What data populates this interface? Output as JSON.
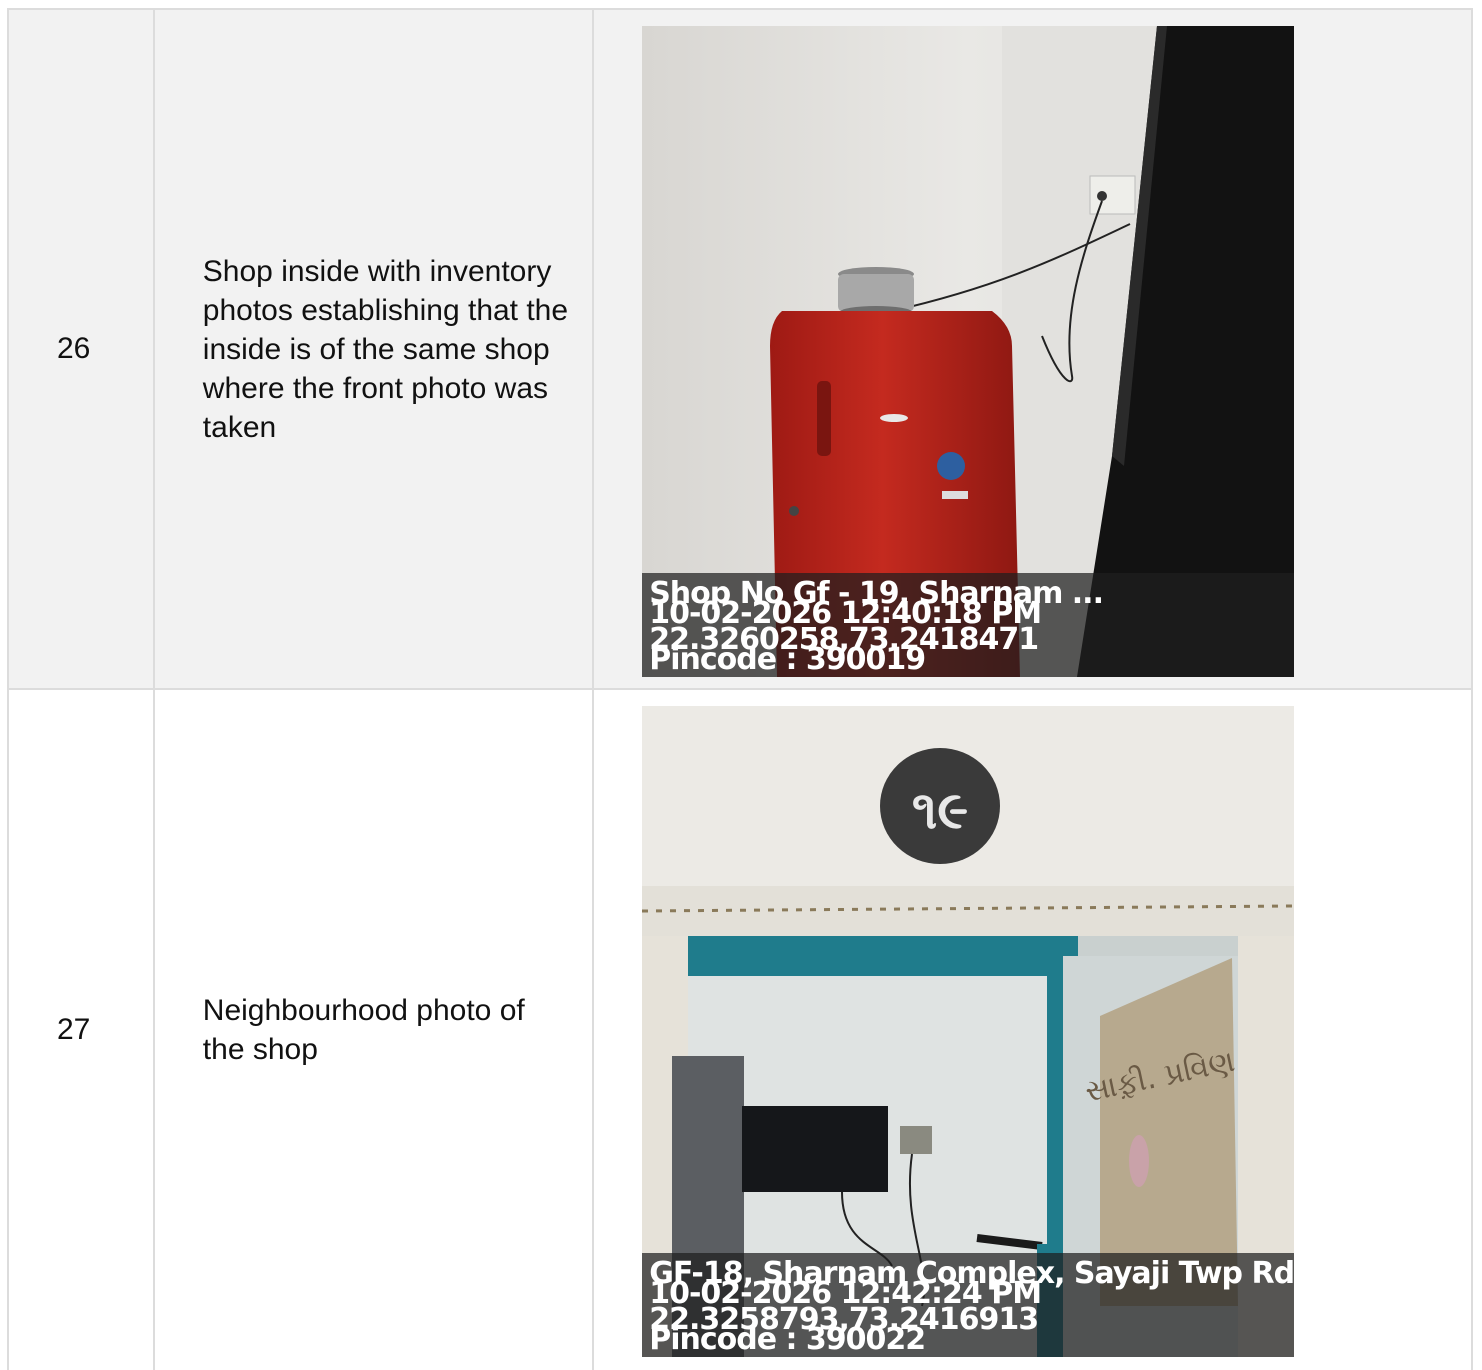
{
  "rows": [
    {
      "number": "26",
      "description": "Shop inside with inventory photos establishing that the inside is of the same shop where the front photo was taken",
      "photo": {
        "subject": "red refrigerator beside black door",
        "overlay": {
          "address": "Shop No Gf - 19, Sharnam ...",
          "datetime": "10-02-2026 12:40:18 PM",
          "coords": "22.3260258,73.2418471",
          "pincode": "Pincode : 390019"
        }
      }
    },
    {
      "number": "27",
      "description": "Neighbourhood photo of the shop",
      "photo": {
        "subject": "shop doorway with number sign and wall-mounted TV",
        "overlay": {
          "address": "GF-18, Sharnam Complex, Sayaji Twp Rd, ...",
          "datetime": "10-02-2026 12:42:24 PM",
          "coords": "22.3258793,73.2416913",
          "pincode": "Pincode : 390022"
        }
      }
    }
  ]
}
